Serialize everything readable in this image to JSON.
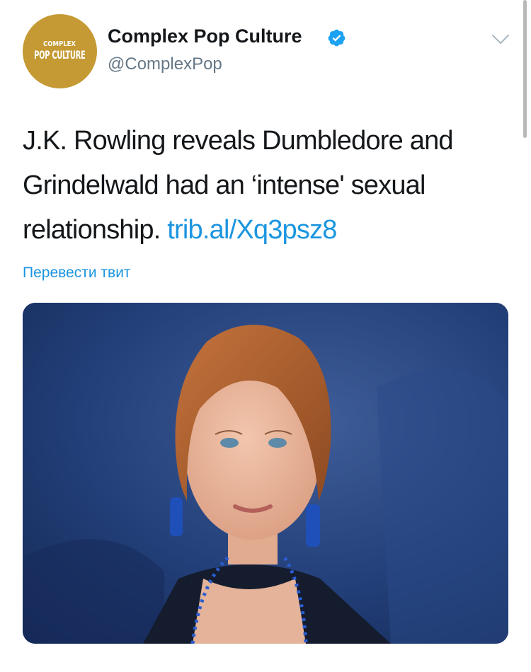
{
  "tweet": {
    "avatar": {
      "brand_top": "COMPLEX",
      "brand_main": "POP CULTURE"
    },
    "display_name": "Complex Pop Culture",
    "handle": "@ComplexPop",
    "verified_icon": "verified-badge-icon",
    "menu_icon": "chevron-down-icon",
    "text": "J.K. Rowling reveals Dumbledore and Grindelwald had an ‘intense' sexual relationship.",
    "link": "trib.al/Xq3psz8",
    "translate_label": "Перевести твит"
  },
  "colors": {
    "link": "#1b95e0",
    "verified": "#1da1f2",
    "avatar_bg": "#c59a34",
    "secondary_text": "#657786"
  }
}
